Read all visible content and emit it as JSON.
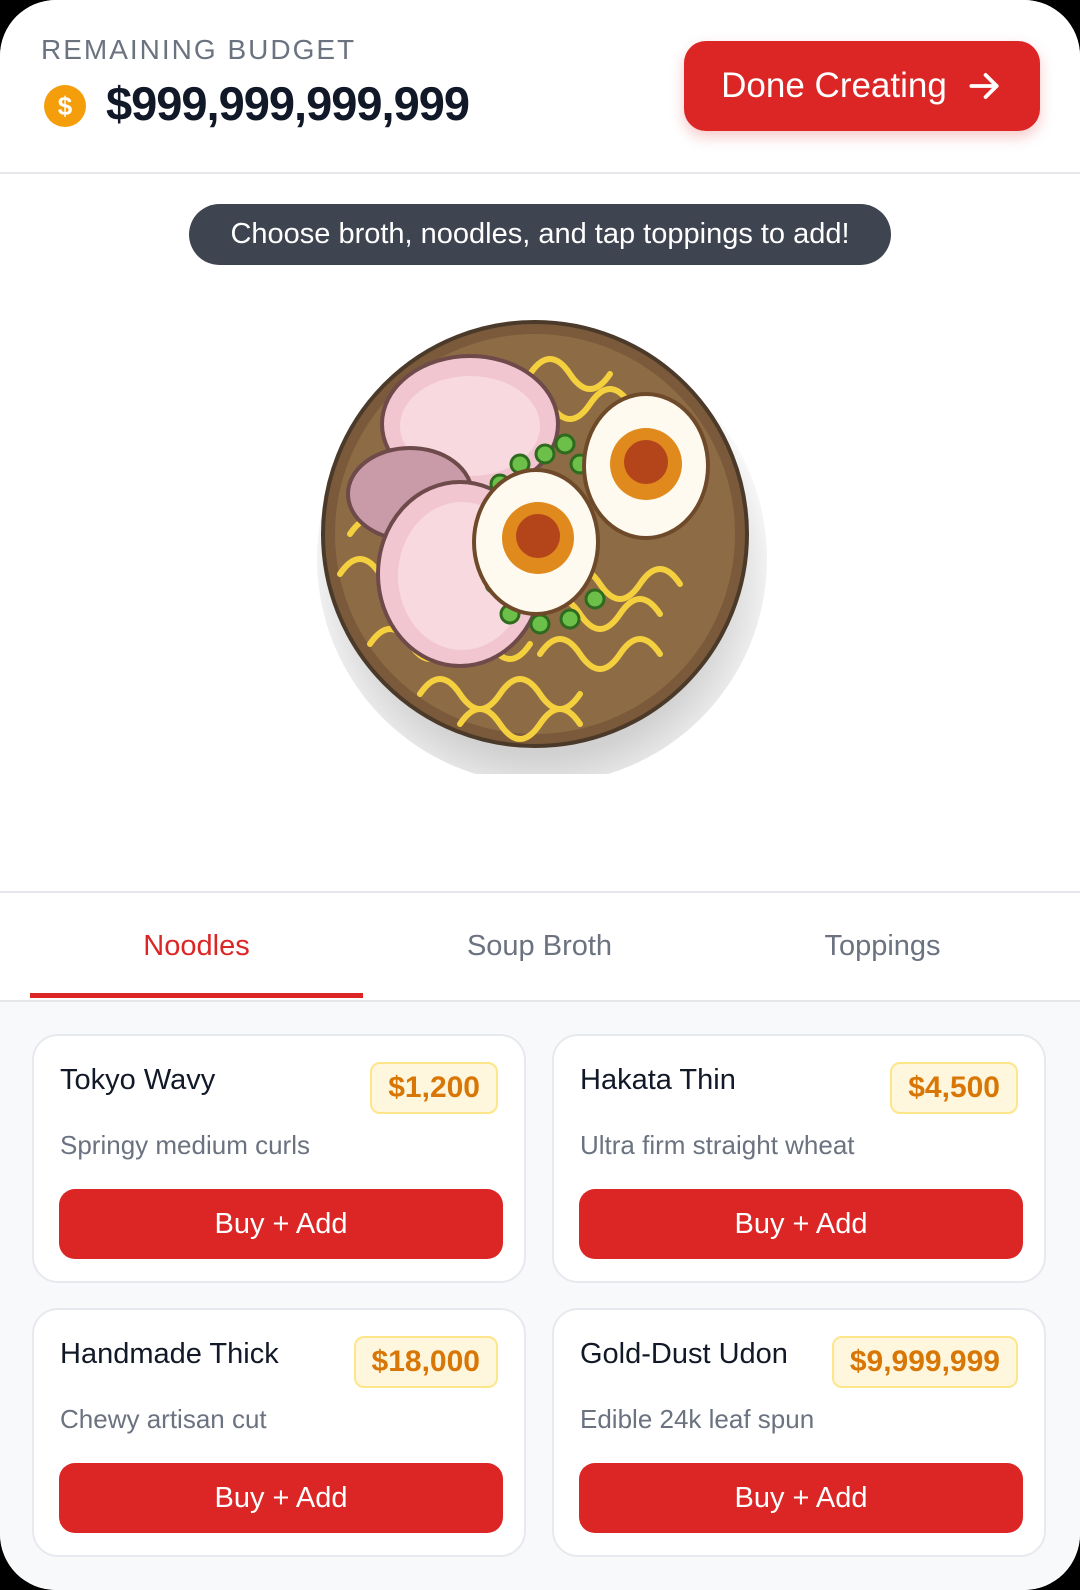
{
  "header": {
    "budget_label": "REMAINING BUDGET",
    "coin_symbol": "$",
    "budget_value": "$999,999,999,999",
    "done_label": "Done Creating"
  },
  "preview": {
    "hint": "Choose broth, noodles, and tap toppings to add!"
  },
  "tabs": [
    {
      "label": "Noodles",
      "active": true
    },
    {
      "label": "Soup Broth",
      "active": false
    },
    {
      "label": "Toppings",
      "active": false
    }
  ],
  "items": [
    {
      "name": "Tokyo Wavy",
      "price": "$1,200",
      "desc": "Springy medium curls",
      "button": "Buy + Add"
    },
    {
      "name": "Hakata Thin",
      "price": "$4,500",
      "desc": "Ultra firm straight wheat",
      "button": "Buy + Add"
    },
    {
      "name": "Handmade Thick",
      "price": "$18,000",
      "desc": "Chewy artisan cut",
      "button": "Buy + Add"
    },
    {
      "name": "Gold-Dust Udon",
      "price": "$9,999,999",
      "desc": "Edible 24k leaf spun",
      "button": "Buy + Add"
    }
  ],
  "colors": {
    "accent": "#dc2626",
    "coin": "#f59e0b",
    "price_text": "#d97706",
    "hint_bg": "#3f4451"
  }
}
